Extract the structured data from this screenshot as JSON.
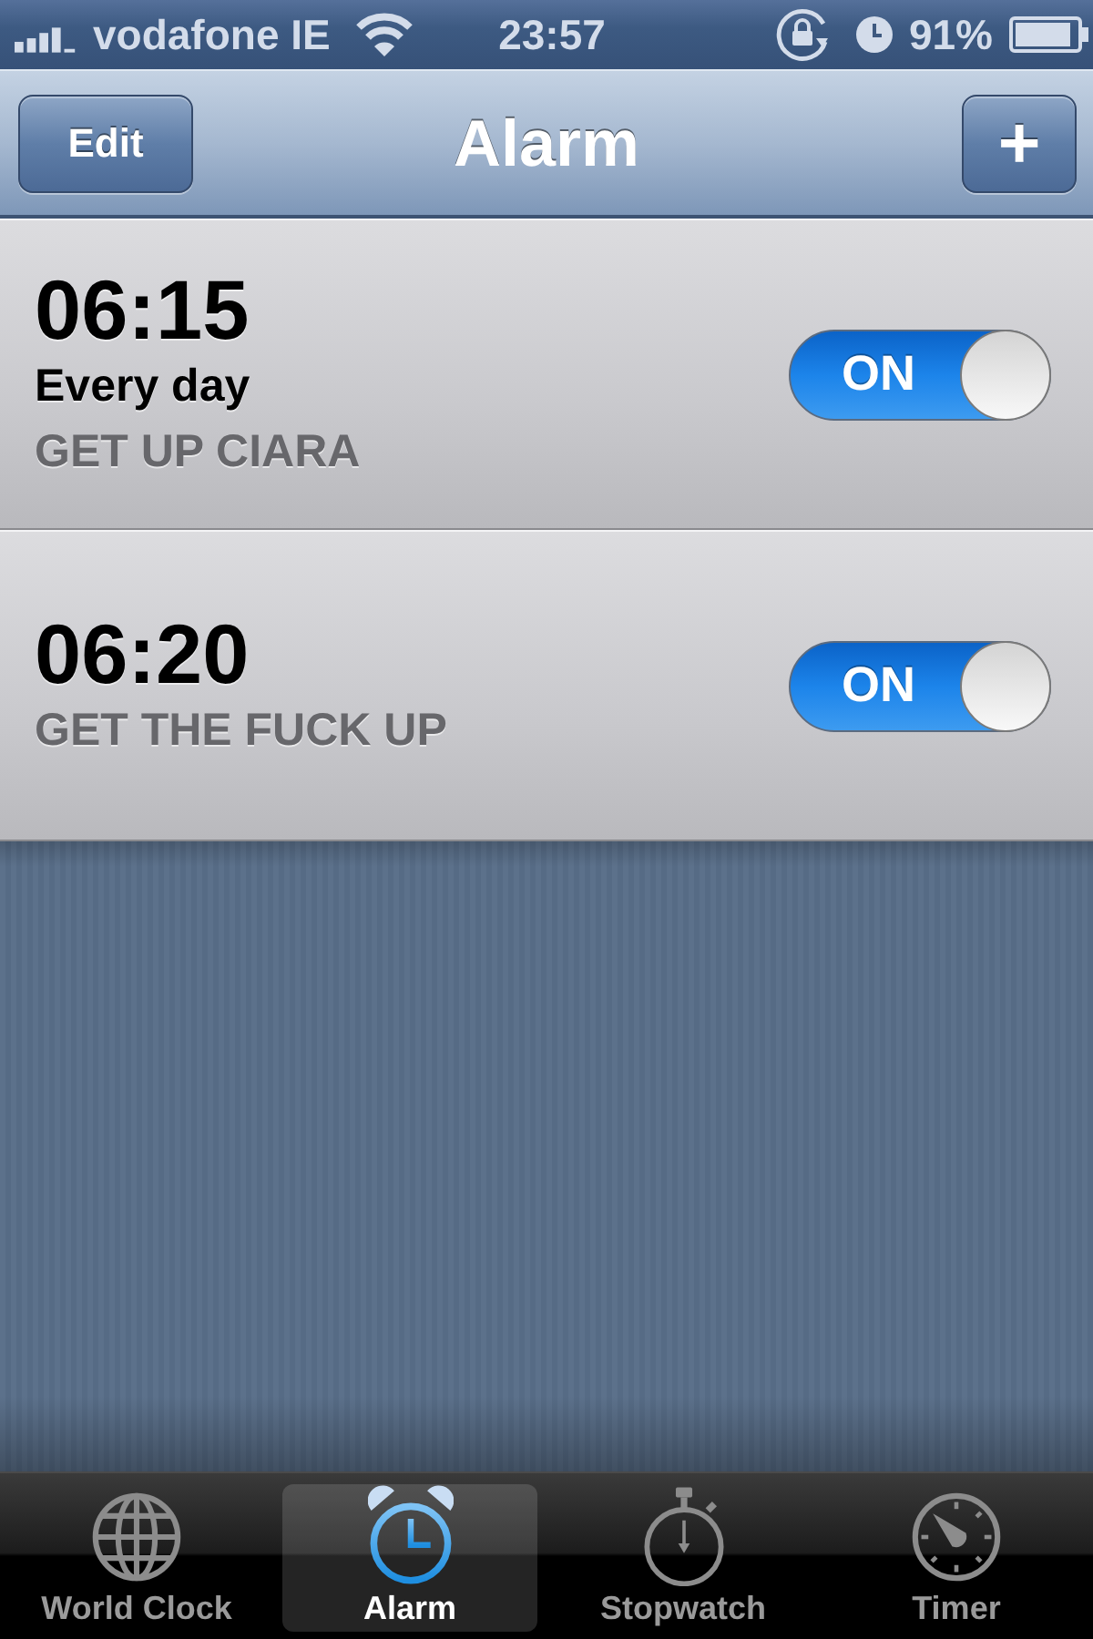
{
  "status_bar": {
    "carrier": "vodafone IE",
    "time": "23:57",
    "battery": "91%"
  },
  "nav_bar": {
    "edit_button": "Edit",
    "title": "Alarm",
    "add_button": "+"
  },
  "alarms": [
    {
      "time": "06:15",
      "repeat": "Every day",
      "label": "GET UP CIARA",
      "toggle": "ON",
      "on": true
    },
    {
      "time": "06:20",
      "label": "GET THE FUCK UP",
      "toggle": "ON",
      "on": true
    }
  ],
  "tab_bar": [
    {
      "kind": "globe",
      "label": "World Clock",
      "selected": false
    },
    {
      "kind": "alarm",
      "label": "Alarm",
      "selected": true
    },
    {
      "kind": "stopwatch",
      "label": "Stopwatch",
      "selected": false
    },
    {
      "kind": "timer",
      "label": "Timer",
      "selected": false
    }
  ]
}
